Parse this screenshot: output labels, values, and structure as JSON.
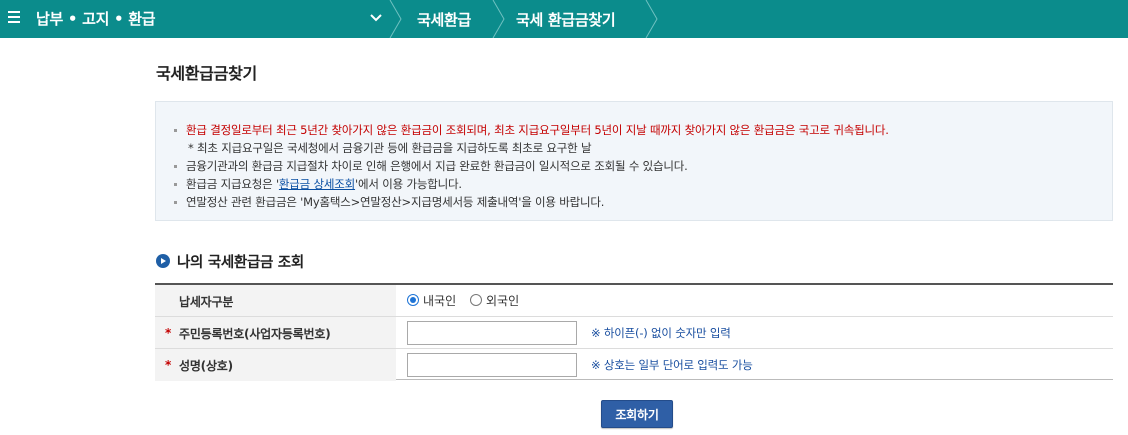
{
  "topbar": {
    "menu_title": "납부 • 고지 • 환급",
    "breadcrumbs": [
      "국세환급",
      "국세 환급금찾기"
    ]
  },
  "page": {
    "title": "국세환급금찾기"
  },
  "notice": {
    "items": [
      {
        "text": "환급 결정일로부터 최근 5년간 찾아가지 않은 환급금이 조회되며, 최초 지급요구일부터 5년이 지날 때까지 찾아가지 않은 환급금은 국고로 귀속됩니다.",
        "style": "red"
      },
      {
        "text": "* 최초 지급요구일은 국세청에서 금융기관 등에 환급금을 지급하도록 최초로 요구한 날",
        "style": "sub"
      },
      {
        "text": "금융기관과의 환급금 지급절차 차이로 인해 은행에서 지급 완료한 환급금이 일시적으로 조회될 수 있습니다.",
        "style": "normal"
      },
      {
        "text_before": "환급금 지급요청은 '",
        "link": "환급금 상세조회",
        "text_after": "'에서 이용 가능합니다.",
        "style": "link"
      },
      {
        "text": "연말정산 관련 환급금은 'My홈택스>연말정산>지급명세서등 제출내역'을 이용 바랍니다.",
        "style": "normal"
      }
    ]
  },
  "section": {
    "title": "나의 국세환급금 조회"
  },
  "form": {
    "taxpayer_type": {
      "label": "납세자구분",
      "options": [
        "내국인",
        "외국인"
      ],
      "selected": "내국인"
    },
    "resident_number": {
      "label": "주민등록번호(사업자등록번호)",
      "value": "",
      "hint": "※ 하이픈(-) 없이 숫자만 입력"
    },
    "name": {
      "label": "성명(상호)",
      "value": "",
      "hint": "※ 상호는 일부 단어로 입력도 가능"
    },
    "required_mark": "*"
  },
  "buttons": {
    "search_label": "조회하기"
  },
  "colors": {
    "topbar": "#0b8c8c",
    "button": "#2f5fa6",
    "notice_red": "#c40000",
    "hint_blue": "#1a4fa0"
  }
}
